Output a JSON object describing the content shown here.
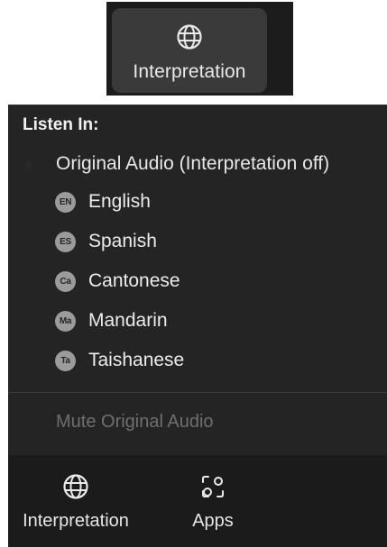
{
  "top_button": {
    "icon": "globe-icon",
    "label": "Interpretation"
  },
  "panel": {
    "header": "Listen In:",
    "original_audio": {
      "label": "Original Audio (Interpretation off)",
      "selected": true
    },
    "languages": [
      {
        "code": "EN",
        "label": "English"
      },
      {
        "code": "ES",
        "label": "Spanish"
      },
      {
        "code": "Ca",
        "label": "Cantonese"
      },
      {
        "code": "Ma",
        "label": "Mandarin"
      },
      {
        "code": "Ta",
        "label": "Taishanese"
      }
    ],
    "mute_original": {
      "label": "Mute Original Audio",
      "enabled": false
    }
  },
  "bottom_bar": {
    "items": [
      {
        "icon": "globe-icon",
        "label": "Interpretation"
      },
      {
        "icon": "apps-icon",
        "label": "Apps"
      }
    ]
  },
  "colors": {
    "panel_bg": "#242424",
    "toolbar_bg": "#1b1b1b",
    "button_bg": "#3a3a3a",
    "badge_bg": "#9b9b9b",
    "text": "#e8e8e8",
    "disabled_text": "#6f6f6f"
  }
}
